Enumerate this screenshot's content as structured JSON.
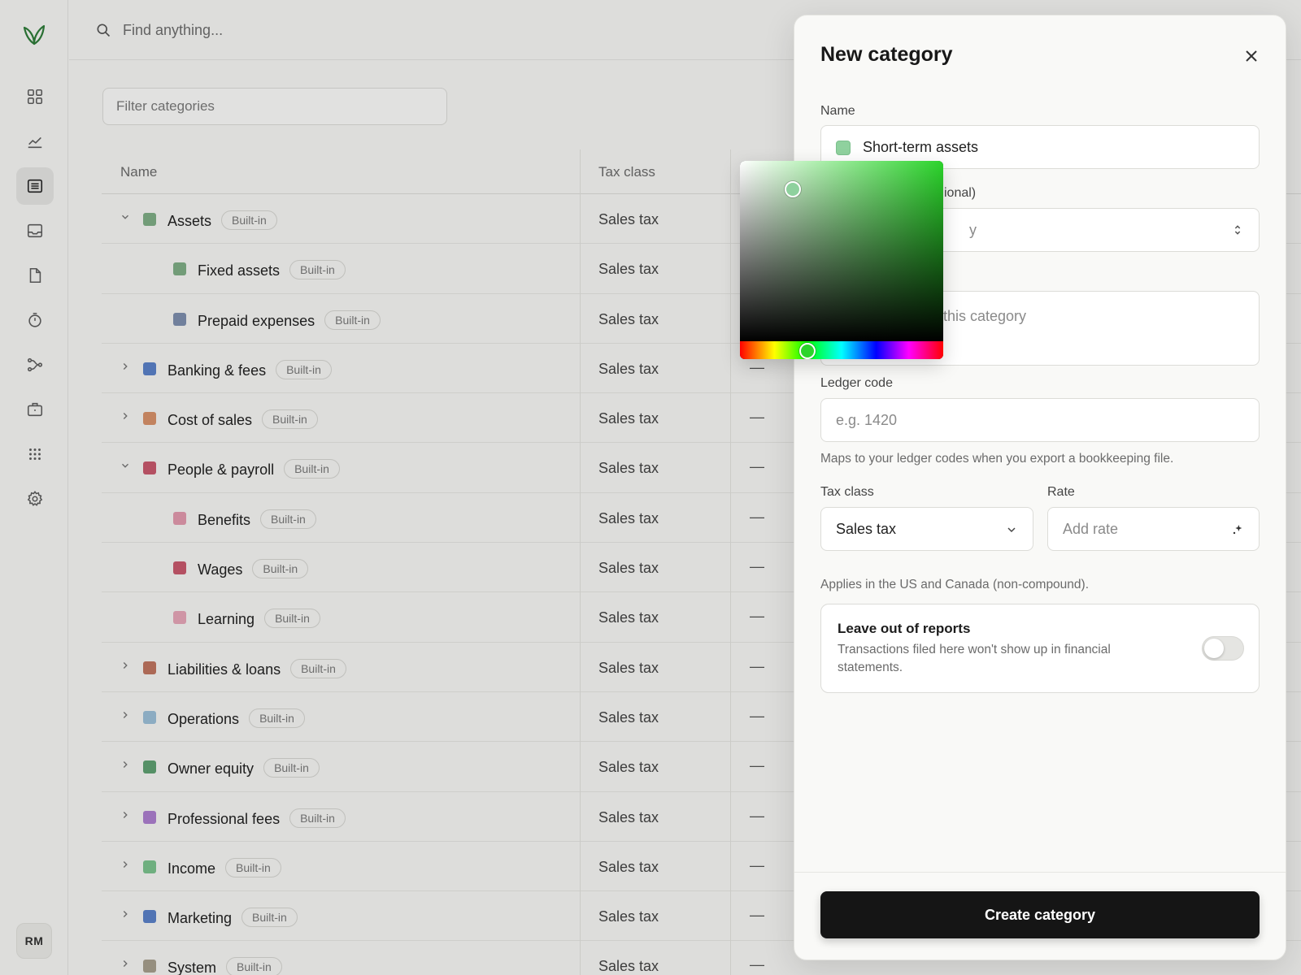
{
  "search": {
    "placeholder": "Find anything..."
  },
  "filter": {
    "placeholder": "Filter categories"
  },
  "table": {
    "headers": {
      "name": "Name",
      "tax_class": "Tax class"
    },
    "rows": [
      {
        "name": "Assets",
        "badge": "Built-in",
        "tax": "Sales tax",
        "dash": "",
        "color": "#7fae86",
        "indent": 0,
        "chevron": "down"
      },
      {
        "name": "Fixed assets",
        "badge": "Built-in",
        "tax": "Sales tax",
        "dash": "",
        "color": "#7fae86",
        "indent": 1,
        "chevron": ""
      },
      {
        "name": "Prepaid expenses",
        "badge": "Built-in",
        "tax": "Sales tax",
        "dash": "",
        "color": "#7e8fae",
        "indent": 1,
        "chevron": ""
      },
      {
        "name": "Banking & fees",
        "badge": "Built-in",
        "tax": "Sales tax",
        "dash": "—",
        "color": "#5b82c9",
        "indent": 0,
        "chevron": "right"
      },
      {
        "name": "Cost of sales",
        "badge": "Built-in",
        "tax": "Sales tax",
        "dash": "—",
        "color": "#d9926a",
        "indent": 0,
        "chevron": "right"
      },
      {
        "name": "People & payroll",
        "badge": "Built-in",
        "tax": "Sales tax",
        "dash": "—",
        "color": "#c95a6e",
        "indent": 0,
        "chevron": "down"
      },
      {
        "name": "Benefits",
        "badge": "Built-in",
        "tax": "Sales tax",
        "dash": "—",
        "color": "#e39aae",
        "indent": 1,
        "chevron": ""
      },
      {
        "name": "Wages",
        "badge": "Built-in",
        "tax": "Sales tax",
        "dash": "—",
        "color": "#c95a6e",
        "indent": 1,
        "chevron": ""
      },
      {
        "name": "Learning",
        "badge": "Built-in",
        "tax": "Sales tax",
        "dash": "—",
        "color": "#e7a6b8",
        "indent": 1,
        "chevron": ""
      },
      {
        "name": "Liabilities & loans",
        "badge": "Built-in",
        "tax": "Sales tax",
        "dash": "—",
        "color": "#c07560",
        "indent": 0,
        "chevron": "right"
      },
      {
        "name": "Operations",
        "badge": "Built-in",
        "tax": "Sales tax",
        "dash": "—",
        "color": "#9cc0d8",
        "indent": 0,
        "chevron": "right"
      },
      {
        "name": "Owner equity",
        "badge": "Built-in",
        "tax": "Sales tax",
        "dash": "—",
        "color": "#5fa172",
        "indent": 0,
        "chevron": "right"
      },
      {
        "name": "Professional fees",
        "badge": "Built-in",
        "tax": "Sales tax",
        "dash": "—",
        "color": "#ad7fd0",
        "indent": 0,
        "chevron": "right"
      },
      {
        "name": "Income",
        "badge": "Built-in",
        "tax": "Sales tax",
        "dash": "—",
        "color": "#7cc38e",
        "indent": 0,
        "chevron": "right"
      },
      {
        "name": "Marketing",
        "badge": "Built-in",
        "tax": "Sales tax",
        "dash": "—",
        "color": "#5b82c9",
        "indent": 0,
        "chevron": "right"
      },
      {
        "name": "System",
        "badge": "Built-in",
        "tax": "Sales tax",
        "dash": "—",
        "color": "#a8a08e",
        "indent": 0,
        "chevron": "right"
      }
    ]
  },
  "sidebar": {
    "avatar": "RM",
    "icons": [
      "dashboard-icon",
      "chart-icon",
      "categories-icon",
      "inbox-icon",
      "document-icon",
      "timer-icon",
      "workflow-icon",
      "briefcase-icon",
      "apps-icon",
      "settings-icon"
    ]
  },
  "panel": {
    "title": "New category",
    "name_label": "Name",
    "name_value": "Short-term assets",
    "name_color": "#8fd19e",
    "parent_label_visible": "ional)",
    "parent_value_visible": "y",
    "description_placeholder_visible": "this category",
    "ledger_label": "Ledger code",
    "ledger_placeholder": "e.g. 1420",
    "ledger_help": "Maps to your ledger codes when you export a bookkeeping file.",
    "tax_class_label": "Tax class",
    "tax_class_value": "Sales tax",
    "rate_label": "Rate",
    "rate_placeholder": "Add rate",
    "tax_help": "Applies in the US and Canada (non-compound).",
    "exclude_title": "Leave out of reports",
    "exclude_desc": "Transactions filed here won't show up in financial statements.",
    "exclude_on": false,
    "create_label": "Create category"
  },
  "color_picker": {
    "hue_color": "#2bd42b",
    "selected_color": "#8fd19e"
  }
}
